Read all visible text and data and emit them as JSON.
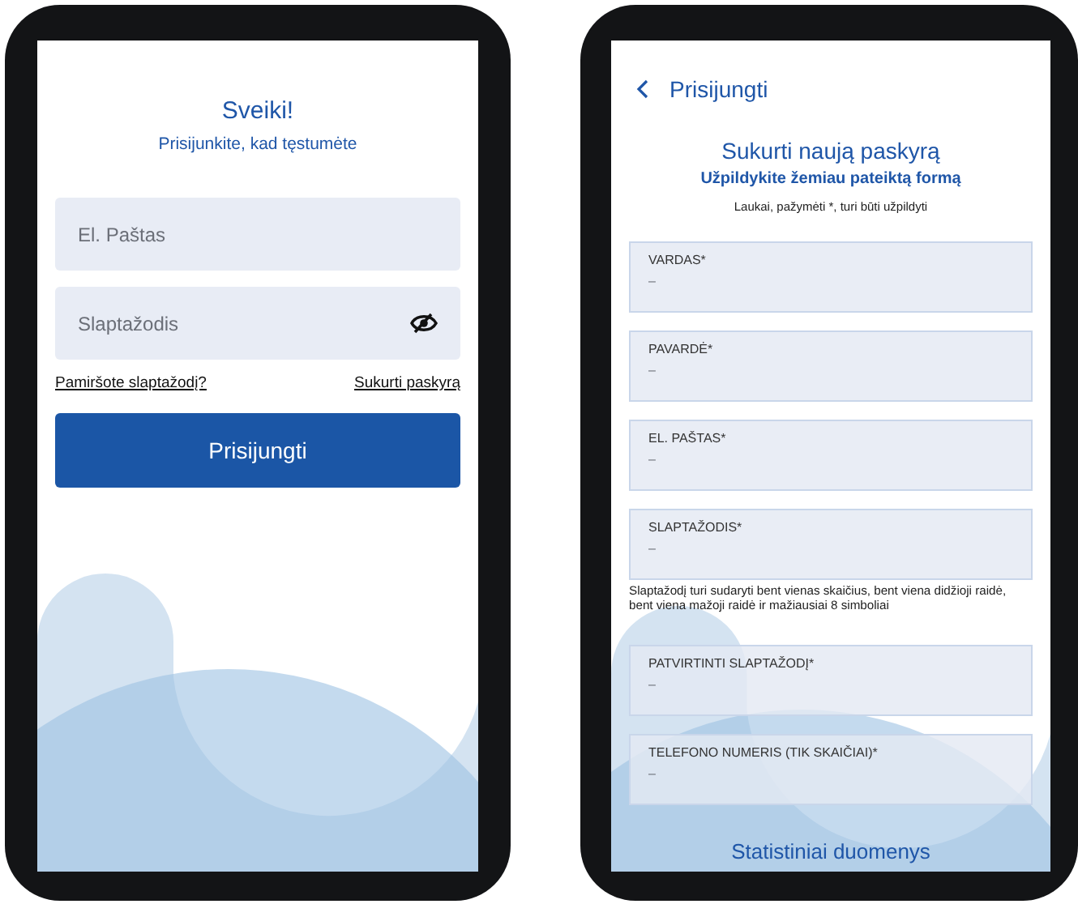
{
  "login": {
    "title": "Sveiki!",
    "subtitle": "Prisijunkite, kad tęstumėte",
    "email_field": {
      "placeholder": "El. Paštas"
    },
    "password_field": {
      "placeholder": "Slaptažodis"
    },
    "links": [
      "Pamiršote slaptažodį?",
      "Sukurti paskyrą"
    ],
    "button": "Prisijungti"
  },
  "register": {
    "back_label": "Prisijungti",
    "title": "Sukurti naują paskyrą",
    "subtitle": "Užpildykite žemiau pateiktą formą",
    "note": "Laukai, pažymėti *, turi būti užpildyti",
    "fields": [
      {
        "label": "VARDAS*",
        "placeholder": "–"
      },
      {
        "label": "PAVARDĖ*",
        "placeholder": "–"
      },
      {
        "label": "EL. PAŠTAS*",
        "placeholder": "–"
      },
      {
        "label": "SLAPTAŽODIS*",
        "placeholder": "–",
        "hint": "Slaptažodį turi sudaryti bent vienas skaičius, bent viena didžioji raidė, bent viena mažoji raidė ir mažiausiai 8 simboliai"
      },
      {
        "label": "PATVIRTINTI SLAPTAŽODĮ*",
        "placeholder": "–"
      },
      {
        "label": "TELEFONO NUMERIS (TIK SKAIČIAI)*",
        "placeholder": "–"
      }
    ],
    "section_title": "Statistiniai duomenys"
  }
}
